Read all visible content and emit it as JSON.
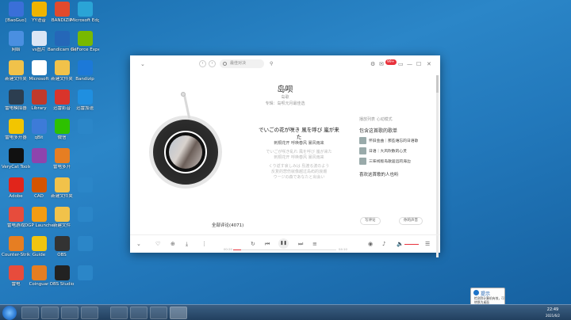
{
  "desktop": {
    "icons": [
      {
        "label": "[BaoGuo]",
        "color": "#3a6fd8"
      },
      {
        "label": "YY语音",
        "color": "#f0b400"
      },
      {
        "label": "BANDIZIP",
        "color": "#e24a2d"
      },
      {
        "label": "Microsoft Edge",
        "color": "#2aa4d6"
      },
      {
        "label": "网络",
        "color": "#4a8fe0"
      },
      {
        "label": "vs图片",
        "color": "#dbe6f5"
      },
      {
        "label": "Bandicam 开始",
        "color": "#2567b8"
      },
      {
        "label": "GeForce Experience",
        "color": "#78b900"
      },
      {
        "label": "新建文件夹",
        "color": "#f1c24a"
      },
      {
        "label": "Microsoft",
        "color": "#ffffff"
      },
      {
        "label": "新建文件夹",
        "color": "#f1c24a"
      },
      {
        "label": "Bandizip",
        "color": "#1c79d8"
      },
      {
        "label": "雷电模拟器",
        "color": "#2c3e50"
      },
      {
        "label": "Library",
        "color": "#c0392b"
      },
      {
        "label": "迅雷影音",
        "color": "#d9342b"
      },
      {
        "label": "迅雷加速",
        "color": "#1f8fe0"
      },
      {
        "label": "雷电多开器",
        "color": "#f2c500"
      },
      {
        "label": "qBit",
        "color": "#3d7bd8"
      },
      {
        "label": "微信",
        "color": "#2dc100"
      },
      {
        "label": "",
        "color": "#2b86c8"
      },
      {
        "label": "VeryCat Tools",
        "color": "#111111"
      },
      {
        "label": "",
        "color": "#8e44ad"
      },
      {
        "label": "雷电多开",
        "color": "#e67e22"
      },
      {
        "label": "",
        "color": "#2b86c8"
      },
      {
        "label": "Adobe",
        "color": "#e1251b"
      },
      {
        "label": "CAD",
        "color": "#d35400"
      },
      {
        "label": "新建文件夹",
        "color": "#f1c24a"
      },
      {
        "label": "",
        "color": "#2b86c8"
      },
      {
        "label": "雷电游戏",
        "color": "#e74c3c"
      },
      {
        "label": "DGP Launcher",
        "color": "#f39c12"
      },
      {
        "label": "新建文件",
        "color": "#f1c24a"
      },
      {
        "label": "",
        "color": "#2b86c8"
      },
      {
        "label": "Counter-Strike",
        "color": "#e67e22"
      },
      {
        "label": "Guide",
        "color": "#f1c40f"
      },
      {
        "label": "OBS",
        "color": "#333333"
      },
      {
        "label": "",
        "color": "#2b86c8"
      },
      {
        "label": "雷电",
        "color": "#e74c3c"
      },
      {
        "label": "Coinguar",
        "color": "#e67e22"
      },
      {
        "label": "OBS Studio",
        "color": "#222222"
      },
      {
        "label": "",
        "color": "#2b86c8"
      }
    ]
  },
  "player": {
    "search_placeholder": "最佳对决",
    "badge": "99+",
    "song_title": "岛呗",
    "song_artist": "岛歌",
    "song_album": "专辑：岛呗元月最佳选",
    "lyrics": [
      {
        "type": "cur",
        "text": "でいごの花が咲き 風を呼び 嵐が来"
      },
      {
        "type": "cur",
        "text": "た"
      },
      {
        "type": "curt",
        "text": "刺桐花开 呼唤春风 暴风雨来"
      },
      {
        "type": "l",
        "text": "でいごが咲き乱れ 風を呼び 嵐が来た"
      },
      {
        "type": "l",
        "text": "刺桐花开 呼唤春风 暴风雨来"
      },
      {
        "type": "l",
        "text": "くり返す哀しみは 島渡る波のよう"
      },
      {
        "type": "l",
        "text": "反复的悲伤就像越过岛屿的浪潮"
      },
      {
        "type": "l",
        "text": "ウージの森であなたと出会い"
      }
    ],
    "side_header": "播放列表  心动模式",
    "side_section": "包含这首歌的歌单",
    "side_items": [
      "怀旧金曲｜那些难忘的日语歌",
      "日语｜大风吹散的心灵",
      "三味线版岛歌遥远的海边"
    ],
    "side_more": "喜欢这首歌的人也听",
    "comments_label": "全部评论(4071)",
    "btn_comment": "写评论",
    "btn_user": "你的声音",
    "time_current": "00:20",
    "time_total": "04:10",
    "progress_fraction": 0.08
  },
  "tray": {
    "time": "22:49",
    "date": "2021/6/2"
  },
  "toast": {
    "title": "提示",
    "body": "检测到计算机有效，可转换为桌面"
  }
}
